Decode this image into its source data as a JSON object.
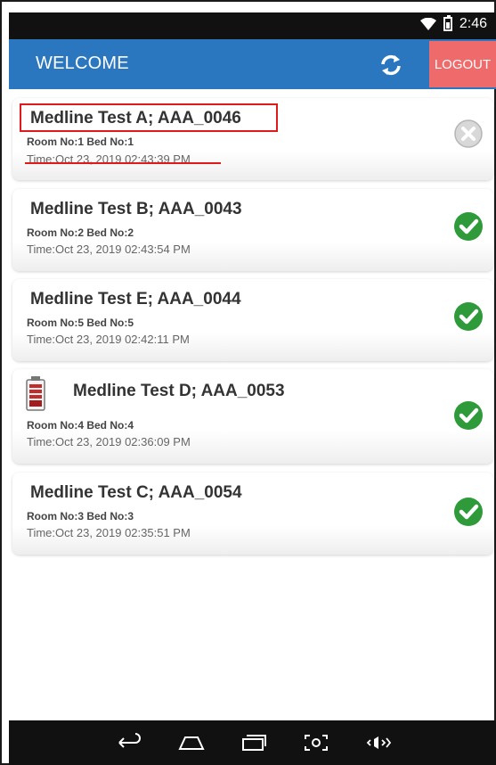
{
  "status_bar": {
    "time": "2:46"
  },
  "app_bar": {
    "title": "WELCOME",
    "logout_label": "LOGOUT"
  },
  "patients": [
    {
      "name": "Medline Test A; AAA_0046",
      "room": "Room No:1  Bed No:1",
      "time": "Time:Oct 23, 2019 02:43:39 PM",
      "status": "cancelled",
      "highlighted": true
    },
    {
      "name": "Medline Test B; AAA_0043",
      "room": "Room No:2  Bed No:2",
      "time": "Time:Oct 23, 2019 02:43:54 PM",
      "status": "done"
    },
    {
      "name": "Medline Test E; AAA_0044",
      "room": "Room No:5  Bed No:5",
      "time": "Time:Oct 23, 2019 02:42:11 PM",
      "status": "done"
    },
    {
      "name": "Medline Test D; AAA_0053",
      "room": "Room No:4  Bed No:4",
      "time": "Time:Oct 23, 2019 02:36:09 PM",
      "status": "done",
      "has_device_icon": true
    },
    {
      "name": "Medline Test C; AAA_0054",
      "room": "Room No:3  Bed No:3",
      "time": "Time:Oct 23, 2019 02:35:51 PM",
      "status": "done"
    }
  ],
  "icons": {
    "sync": "sync-icon",
    "done": "check-circle-icon",
    "cancelled": "x-circle-icon",
    "device": "battery-device-icon",
    "nav": [
      "back-icon",
      "home-icon",
      "recent-apps-icon",
      "screenshot-icon",
      "volume-icon"
    ]
  },
  "colors": {
    "app_bar": "#2a77bf",
    "logout": "#ef6b6b",
    "check": "#2e9a3a",
    "highlight": "#e01a1a"
  }
}
